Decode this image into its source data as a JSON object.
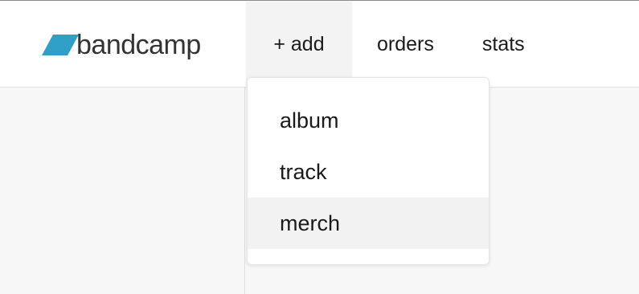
{
  "header": {
    "logo_text": "bandcamp",
    "logo_color": "#2f9fc7",
    "nav": {
      "add_label": "+ add",
      "orders_label": "orders",
      "stats_label": "stats"
    }
  },
  "add_menu": {
    "items": [
      {
        "label": "album"
      },
      {
        "label": "track"
      },
      {
        "label": "merch",
        "highlighted": true
      }
    ]
  }
}
